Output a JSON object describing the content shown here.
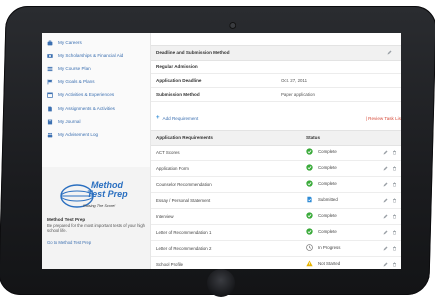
{
  "sidebar": {
    "items": [
      {
        "label": "My Careers",
        "icon": "briefcase-icon"
      },
      {
        "label": "My Scholarships & Financial Aid",
        "icon": "money-icon"
      },
      {
        "label": "My Course Plan",
        "icon": "list-icon"
      },
      {
        "label": "My Goals & Plans",
        "icon": "flag-icon"
      },
      {
        "label": "My Activities & Experiences",
        "icon": "calendar-icon"
      },
      {
        "label": "My Assignments & Activities",
        "icon": "document-icon"
      },
      {
        "label": "My Journal",
        "icon": "book-icon"
      },
      {
        "label": "My Advisement Log",
        "icon": "people-icon"
      }
    ],
    "promo": {
      "logo_line1": "Method",
      "logo_line2": "Test Prep",
      "logo_tagline": "Raising The Score!",
      "title": "Method Test Prep",
      "description": "Be prepared for the most important tests of your high school life.",
      "link": "Go to Method Test Prep"
    }
  },
  "main": {
    "section_title": "Deadline and Submission Method",
    "admission_type": "Regular Admission",
    "deadline_label": "Application Deadline",
    "deadline_value": "Oct. 27, 2011",
    "method_label": "Submission Method",
    "method_value": "Paper application",
    "add_requirement": "Add Requirement",
    "review_link": "| Review Task Lis",
    "table": {
      "col_requirements": "Application Requirements",
      "col_status": "Status",
      "rows": [
        {
          "name": "ACT Scores",
          "status": "Complete",
          "kind": "complete"
        },
        {
          "name": "Application Form",
          "status": "Complete",
          "kind": "complete"
        },
        {
          "name": "Counselor Recommendation",
          "status": "Complete",
          "kind": "complete"
        },
        {
          "name": "Essay / Personal Statement",
          "status": "Submitted",
          "kind": "submitted"
        },
        {
          "name": "Interview",
          "status": "Complete",
          "kind": "complete"
        },
        {
          "name": "Letter of Recommendation 1",
          "status": "Complete",
          "kind": "complete"
        },
        {
          "name": "Letter of Recommendation 2",
          "status": "In Progress",
          "kind": "progress"
        },
        {
          "name": "School Profile",
          "status": "Not Started",
          "kind": "notstarted"
        }
      ]
    }
  },
  "colors": {
    "link": "#3b6fb0",
    "complete": "#3aaa3a",
    "submitted": "#2e8bd6",
    "warning": "#e8b400",
    "review": "#d64b3a"
  }
}
